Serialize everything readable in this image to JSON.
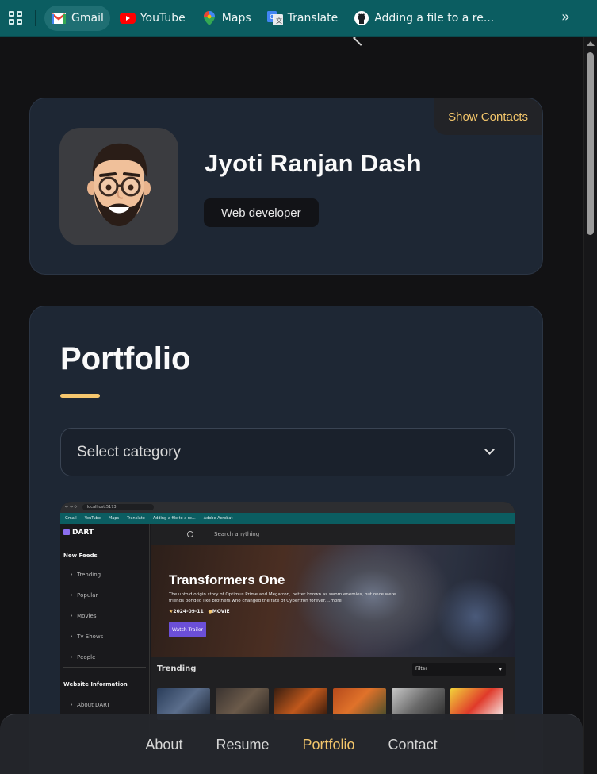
{
  "bookmarks": [
    {
      "label": "Gmail",
      "icon": "gmail-icon",
      "active": true
    },
    {
      "label": "YouTube",
      "icon": "youtube-icon"
    },
    {
      "label": "Maps",
      "icon": "maps-icon"
    },
    {
      "label": "Translate",
      "icon": "translate-icon"
    },
    {
      "label": "Adding a file to a re...",
      "icon": "github-icon"
    }
  ],
  "profile": {
    "name": "Jyoti Ranjan Dash",
    "role": "Web developer",
    "show_contacts": "Show Contacts"
  },
  "portfolio": {
    "title": "Portfolio",
    "select_placeholder": "Select category"
  },
  "project_preview": {
    "browser_url": "localhost:5173",
    "bookmarks": [
      "Gmail",
      "YouTube",
      "Maps",
      "Translate",
      "Adding a file to a re...",
      "Adobe Acrobat"
    ],
    "logo": "DART",
    "sidebar_heading_1": "New Feeds",
    "sidebar_items": [
      "Trending",
      "Popular",
      "Movies",
      "Tv Shows",
      "People"
    ],
    "sidebar_heading_2": "Website Information",
    "sidebar_item_about": "About DART",
    "search_placeholder": "Search anything",
    "hero_title": "Transformers One",
    "hero_desc": "The untold origin story of Optimus Prime and Megatron, better known as sworn enemies, but once were friends bonded like brothers who changed the fate of Cybertron forever....more",
    "hero_date": "2024-09-11",
    "hero_type": "MOVIE",
    "hero_button": "Watch Trailer",
    "trending_title": "Trending",
    "filter_label": "Filter"
  },
  "nav": {
    "items": [
      "About",
      "Resume",
      "Portfolio",
      "Contact"
    ],
    "active": "Portfolio"
  },
  "colors": {
    "accent": "#f2c56b",
    "card_bg": "#1e2734",
    "bookmark_bar": "#0b5d61",
    "page_bg": "#121214"
  }
}
